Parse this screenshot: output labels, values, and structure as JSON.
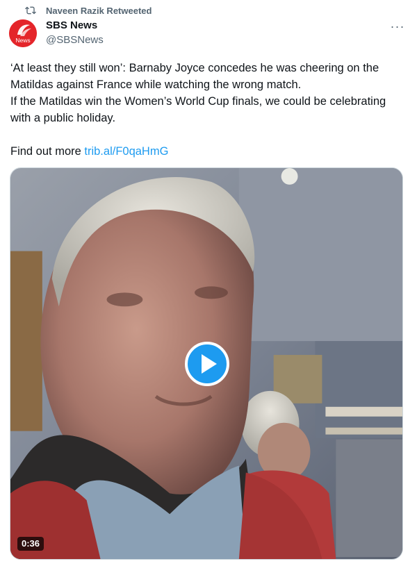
{
  "social_context": {
    "text": "Naveen Razik Retweeted",
    "icon": "retweet-icon"
  },
  "author": {
    "name": "SBS News",
    "handle": "@SBSNews",
    "avatar_text": "News",
    "avatar_color": "#e4252a"
  },
  "tweet": {
    "line1": "‘At least they still won’: Barnaby Joyce concedes  he was cheering on the Matildas against France while watching the wrong match.",
    "line2": "If the Matildas win the Women’s World Cup finals, we could be celebrating with a public holiday.",
    "find_more": "Find out more",
    "link_text": "trib.al/F0qaHmG"
  },
  "media": {
    "type": "video",
    "duration": "0:36",
    "play_icon": "play-icon"
  },
  "colors": {
    "accent": "#1d9bf0",
    "text": "#0f1419",
    "muted": "#536471"
  }
}
